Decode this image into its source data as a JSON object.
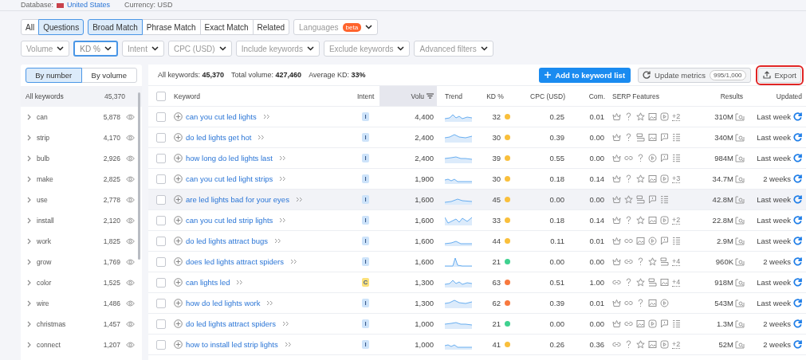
{
  "header": {
    "database_label": "Database:",
    "database_value": "United States",
    "currency": "Currency: USD"
  },
  "type_tabs": [
    {
      "label": "All",
      "selected": false
    },
    {
      "label": "Questions",
      "selected": true
    }
  ],
  "match_tabs": [
    {
      "label": "Broad Match",
      "selected": true
    },
    {
      "label": "Phrase Match",
      "selected": false
    },
    {
      "label": "Exact Match",
      "selected": false
    },
    {
      "label": "Related",
      "selected": false
    }
  ],
  "languages": {
    "label": "Languages",
    "badge": "beta"
  },
  "filters": [
    {
      "label": "Volume",
      "active": false
    },
    {
      "label": "KD %",
      "active": true
    },
    {
      "label": "Intent",
      "active": false
    },
    {
      "label": "CPC (USD)",
      "active": false
    },
    {
      "label": "Include keywords",
      "active": false
    },
    {
      "label": "Exclude keywords",
      "active": false
    },
    {
      "label": "Advanced filters",
      "active": false
    }
  ],
  "group_toggle": [
    {
      "label": "By number",
      "selected": true
    },
    {
      "label": "By volume",
      "selected": false
    }
  ],
  "groups_header": {
    "label": "All keywords",
    "count": "45,370"
  },
  "groups": [
    {
      "label": "can",
      "count": "5,878"
    },
    {
      "label": "strip",
      "count": "4,170"
    },
    {
      "label": "bulb",
      "count": "2,926"
    },
    {
      "label": "make",
      "count": "2,825"
    },
    {
      "label": "use",
      "count": "2,778"
    },
    {
      "label": "install",
      "count": "2,120"
    },
    {
      "label": "work",
      "count": "1,825"
    },
    {
      "label": "grow",
      "count": "1,769"
    },
    {
      "label": "color",
      "count": "1,525"
    },
    {
      "label": "wire",
      "count": "1,486"
    },
    {
      "label": "christmas",
      "count": "1,457"
    },
    {
      "label": "connect",
      "count": "1,207"
    }
  ],
  "summary": [
    "All keywords: **45,370**",
    "Total volume: **427,460**",
    "Average KD: **33%**"
  ],
  "actions": {
    "add": "Add to keyword list",
    "update": "Update metrics",
    "update_badge": "995/1,000",
    "export": "Export",
    "export_highlighted": true
  },
  "select_all": {
    "checked": false
  },
  "columns": [
    {
      "label": "Keyword",
      "sorted": false
    },
    {
      "label": "Intent",
      "sorted": false
    },
    {
      "label": "Volu",
      "sorted": true
    },
    {
      "label": "Trend",
      "sorted": false
    },
    {
      "label": "KD %",
      "sorted": false
    },
    {
      "label": "CPC (USD)",
      "sorted": false
    },
    {
      "label": "Com.",
      "sorted": false
    },
    {
      "label": "SERP Features",
      "sorted": false
    },
    {
      "label": "Results",
      "sorted": false
    },
    {
      "label": "Updated",
      "sorted": false
    }
  ],
  "rows": [
    {
      "checked": false,
      "selected": false,
      "keyword": "can you cut led lights",
      "intent": {
        "label": "I",
        "color": "#cde3fa"
      },
      "volume": "4,400",
      "kd": "32",
      "color": "#f9bf3b",
      "cpc": "0.25",
      "com": "0.01",
      "serp": [
        {
          "kind": "crown"
        },
        {
          "kind": "question"
        },
        {
          "kind": "star"
        },
        {
          "kind": "image"
        },
        {
          "kind": "video"
        }
      ],
      "serp_more": "+2",
      "results": "310M",
      "updated": "Last week"
    },
    {
      "checked": false,
      "selected": false,
      "keyword": "do led lights get hot",
      "intent": {
        "label": "I",
        "color": "#cde3fa"
      },
      "volume": "2,400",
      "kd": "30",
      "color": "#f9bf3b",
      "cpc": "0.39",
      "com": "0.00",
      "serp": [
        {
          "kind": "crown"
        },
        {
          "kind": "question"
        },
        {
          "kind": "box"
        },
        {
          "kind": "image"
        },
        {
          "kind": "comment"
        },
        {
          "kind": "list"
        }
      ],
      "results": "340M",
      "updated": "Last week"
    },
    {
      "checked": false,
      "selected": false,
      "keyword": "how long do led lights last",
      "intent": {
        "label": "I",
        "color": "#cde3fa"
      },
      "volume": "2,400",
      "kd": "39",
      "color": "#f9bf3b",
      "cpc": "0.55",
      "com": "0.00",
      "serp": [
        {
          "kind": "crown"
        },
        {
          "kind": "link"
        },
        {
          "kind": "question"
        },
        {
          "kind": "play"
        },
        {
          "kind": "comment"
        },
        {
          "kind": "list"
        }
      ],
      "results": "984M",
      "updated": "Last week"
    },
    {
      "checked": false,
      "selected": false,
      "keyword": "can you cut led light strips",
      "intent": {
        "label": "I",
        "color": "#cde3fa"
      },
      "volume": "1,900",
      "kd": "30",
      "color": "#f9bf3b",
      "cpc": "0.18",
      "com": "0.14",
      "serp": [
        {
          "kind": "crown"
        },
        {
          "kind": "question"
        },
        {
          "kind": "star"
        },
        {
          "kind": "image"
        },
        {
          "kind": "video"
        }
      ],
      "serp_more": "+3",
      "results": "34.7M",
      "updated": "2 weeks"
    },
    {
      "checked": false,
      "selected": true,
      "keyword": "are led lights bad for your eyes",
      "intent": {
        "label": "I",
        "color": "#cde3fa"
      },
      "volume": "1,600",
      "kd": "45",
      "color": "#f9bf3b",
      "cpc": "0.00",
      "com": "0.00",
      "serp": [
        {
          "kind": "crown"
        },
        {
          "kind": "star"
        },
        {
          "kind": "box"
        },
        {
          "kind": "comment"
        },
        {
          "kind": "list"
        }
      ],
      "results": "42.8M",
      "updated": "Last week"
    },
    {
      "checked": false,
      "selected": false,
      "keyword": "can you cut led strip lights",
      "intent": {
        "label": "I",
        "color": "#cde3fa"
      },
      "volume": "1,600",
      "kd": "33",
      "color": "#f9bf3b",
      "cpc": "0.18",
      "com": "0.14",
      "serp": [
        {
          "kind": "crown"
        },
        {
          "kind": "question"
        },
        {
          "kind": "star"
        },
        {
          "kind": "image"
        },
        {
          "kind": "video"
        }
      ],
      "serp_more": "+2",
      "results": "22.8M",
      "updated": "Last week"
    },
    {
      "checked": false,
      "selected": false,
      "keyword": "do led lights attract bugs",
      "intent": {
        "label": "I",
        "color": "#cde3fa"
      },
      "volume": "1,600",
      "kd": "44",
      "color": "#f9bf3b",
      "cpc": "0.11",
      "com": "0.01",
      "serp": [
        {
          "kind": "crown"
        },
        {
          "kind": "link"
        },
        {
          "kind": "image"
        },
        {
          "kind": "play"
        },
        {
          "kind": "comment"
        },
        {
          "kind": "list"
        }
      ],
      "results": "2.9M",
      "updated": "Last week"
    },
    {
      "checked": false,
      "selected": false,
      "keyword": "does led lights attract spiders",
      "intent": {
        "label": "I",
        "color": "#cde3fa"
      },
      "volume": "1,600",
      "kd": "21",
      "color": "#3fd18f",
      "cpc": "0.00",
      "com": "0.00",
      "serp": [
        {
          "kind": "crown"
        },
        {
          "kind": "link"
        },
        {
          "kind": "question"
        },
        {
          "kind": "star"
        },
        {
          "kind": "box"
        }
      ],
      "serp_more": "+4",
      "results": "960K",
      "updated": "2 weeks"
    },
    {
      "checked": false,
      "selected": false,
      "keyword": "can lights led",
      "intent": {
        "label": "C",
        "color": "#fbe07a"
      },
      "volume": "1,300",
      "kd": "63",
      "color": "#f8793e",
      "cpc": "0.51",
      "com": "1.00",
      "serp": [
        {
          "kind": "link"
        },
        {
          "kind": "question"
        },
        {
          "kind": "star"
        },
        {
          "kind": "box"
        },
        {
          "kind": "image"
        }
      ],
      "serp_more": "+4",
      "results": "918M",
      "updated": "Last week"
    },
    {
      "checked": false,
      "selected": false,
      "keyword": "how do led lights work",
      "intent": {
        "label": "I",
        "color": "#cde3fa"
      },
      "volume": "1,300",
      "kd": "62",
      "color": "#f8793e",
      "cpc": "0.39",
      "com": "0.01",
      "serp": [
        {
          "kind": "crown"
        },
        {
          "kind": "link"
        },
        {
          "kind": "question"
        },
        {
          "kind": "image"
        },
        {
          "kind": "play"
        }
      ],
      "results": "543M",
      "updated": "Last week"
    },
    {
      "checked": false,
      "selected": false,
      "keyword": "do led lights attract spiders",
      "intent": {
        "label": "I",
        "color": "#cde3fa"
      },
      "volume": "1,000",
      "kd": "21",
      "color": "#3fd18f",
      "cpc": "0.00",
      "com": "0.00",
      "serp": [
        {
          "kind": "crown"
        },
        {
          "kind": "link"
        },
        {
          "kind": "image"
        },
        {
          "kind": "video"
        },
        {
          "kind": "comment"
        },
        {
          "kind": "list"
        }
      ],
      "results": "1.3M",
      "updated": "2 weeks"
    },
    {
      "checked": false,
      "selected": false,
      "keyword": "how to install led strip lights",
      "intent": {
        "label": "I",
        "color": "#cde3fa"
      },
      "volume": "1,000",
      "kd": "41",
      "color": "#f9bf3b",
      "cpc": "0.26",
      "com": "0.36",
      "serp": [
        {
          "kind": "link"
        },
        {
          "kind": "question"
        },
        {
          "kind": "star"
        },
        {
          "kind": "image"
        },
        {
          "kind": "video"
        }
      ],
      "serp_more": "+2",
      "results": "52M",
      "updated": "2 weeks"
    }
  ]
}
